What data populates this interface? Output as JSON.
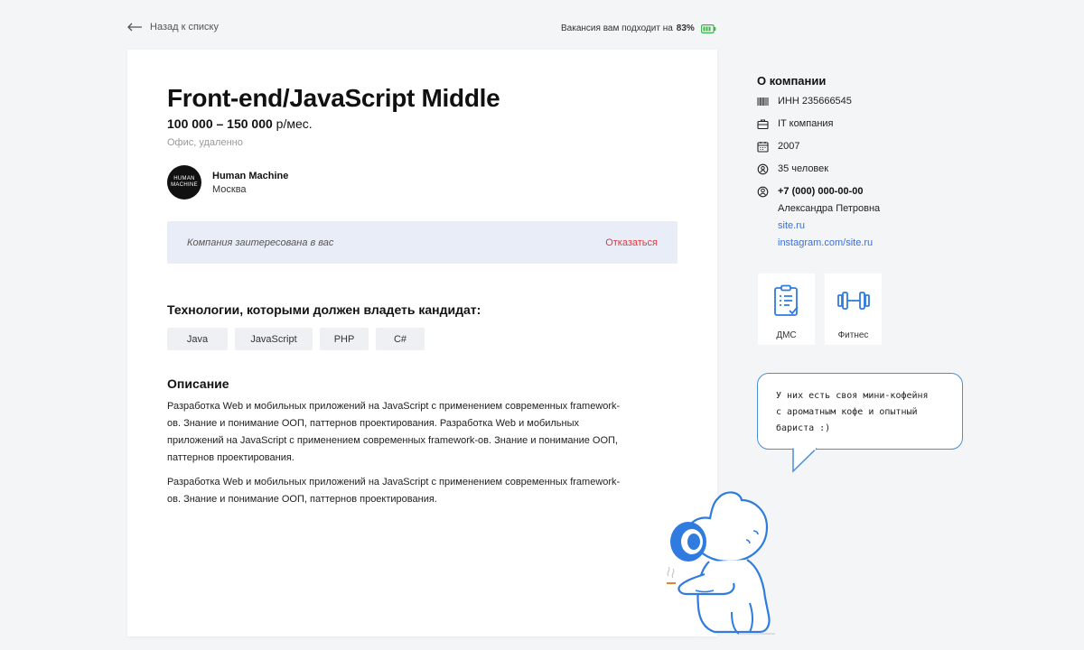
{
  "topbar": {
    "back_label": "Назад к списку",
    "match_prefix": "Вакансия вам подходит на",
    "match_value": "83%"
  },
  "vacancy": {
    "title": "Front-end/JavaScript Middle",
    "salary_range": "100 000 – 150 000",
    "salary_unit": "р/мес.",
    "format": "Офис, удаленно",
    "company": {
      "name": "Human Machine",
      "city": "Москва",
      "logo_text": "HUMAN MACHINE"
    },
    "interest": {
      "text": "Компания заитересована в вас",
      "decline_label": "Отказаться"
    },
    "tech_title": "Технологии, которыми должен владеть кандидат:",
    "tags": [
      "Java",
      "JavaScript",
      "PHP",
      "C#"
    ],
    "desc_title": "Описание",
    "desc_paragraphs": [
      "Разработка Web и мобильных приложений на JavaScript с применением современных framework-ов. Знание и понимание ООП, паттернов проектирования. Разработка Web и мобильных приложений на JavaScript с применением современных framework-ов. Знание и понимание ООП, паттернов проектирования.",
      "Разработка Web и мобильных приложений на JavaScript с применением современных framework-ов. Знание и понимание ООП, паттернов проектирования."
    ]
  },
  "about": {
    "title": "О компании",
    "inn": "ИНН 235666545",
    "type": "IT компания",
    "year": "2007",
    "employees": "35 человек",
    "phone": "+7 (000) 000-00-00",
    "contact_person": "Александра Петровна",
    "site": "site.ru",
    "instagram": "instagram.com/site.ru"
  },
  "benefits": [
    {
      "label": "ДМС",
      "icon": "clipboard-icon"
    },
    {
      "label": "Фитнес",
      "icon": "dumbbell-icon"
    }
  ],
  "bubble": {
    "lines": [
      "У них есть своя мини-кофейня",
      "с ароматным кофе и опытный",
      "бариста :)"
    ]
  },
  "colors": {
    "accent": "#3b6fd8",
    "decline": "#e0393e",
    "interest_bg": "#e8edf7",
    "match_green": "#3bb54a",
    "mascot_blue": "#2f7be0"
  }
}
